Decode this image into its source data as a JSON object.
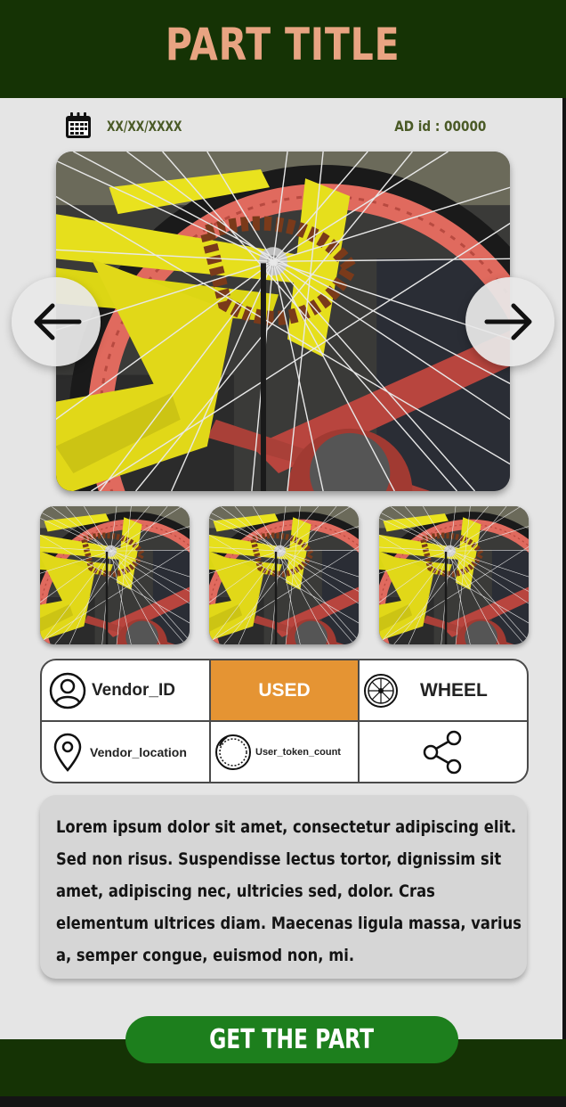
{
  "header": {
    "title": "PART TITLE"
  },
  "meta": {
    "date": "XX/XX/XXXX",
    "ad_id": "AD id : 00000",
    "calendar_icon": "calendar-icon"
  },
  "gallery": {
    "main_image": "bicycle-wheel-photo",
    "prev_icon": "arrow-left-icon",
    "next_icon": "arrow-right-icon",
    "thumbnails": [
      "bicycle-wheel-photo",
      "bicycle-wheel-photo",
      "bicycle-wheel-photo"
    ]
  },
  "info": {
    "vendor_id": "Vendor_ID",
    "condition": "USED",
    "category": "WHEEL",
    "vendor_location": "Vendor_location",
    "user_token_count": "User_token_count",
    "share_icon": "share-icon"
  },
  "description": "Lorem ipsum dolor sit amet, consectetur adipiscing elit. Sed non risus. Suspendisse lectus tortor, dignissim sit amet, adipiscing nec, ultricies sed, dolor. Cras elementum ultrices diam. Maecenas ligula massa, varius a, semper congue, euismod non, mi.",
  "cta": {
    "label": "GET THE PART"
  },
  "colors": {
    "header_bg": "#153305",
    "title": "#e8a482",
    "condition_bg": "#e59433",
    "cta_bg": "#1d7f1d",
    "meta_text": "#4a5a26"
  }
}
